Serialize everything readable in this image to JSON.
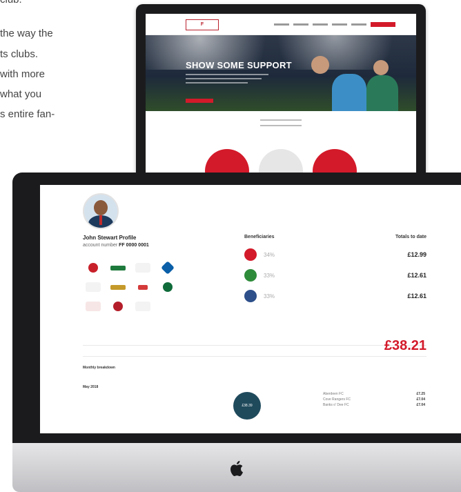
{
  "intro_lines": [
    "club.",
    "the way the",
    "ts clubs.",
    "with more",
    "what you",
    "s entire fan-"
  ],
  "website": {
    "hero_title": "SHOW SOME SUPPORT"
  },
  "dashboard": {
    "profile": {
      "name": "John Stewart Profile",
      "account_label": "account number",
      "account_number": "FF 0000 0001"
    },
    "headers": {
      "beneficiaries": "Beneficiaries",
      "totals": "Totals to date"
    },
    "beneficiaries": [
      {
        "percent": "34%",
        "total": "£12.99",
        "color": "#d31a2a"
      },
      {
        "percent": "33%",
        "total": "£12.61",
        "color": "#2e8b3a"
      },
      {
        "percent": "33%",
        "total": "£12.61",
        "color": "#2d4f8a"
      }
    ],
    "grand_total": "£38.21",
    "monthly_title": "Monthly breakdown",
    "month": "May 2018",
    "bubble_value": "£38.39",
    "club_breakdown": [
      {
        "name": "Aberdeen FC",
        "amount": "£7.25"
      },
      {
        "name": "Cove Rangers FC",
        "amount": "£7.04"
      },
      {
        "name": "Banks o' Dee FC",
        "amount": "£7.04"
      }
    ]
  },
  "colors": {
    "brand_red": "#d31a2a",
    "bubble_teal": "#1f4a5c"
  }
}
